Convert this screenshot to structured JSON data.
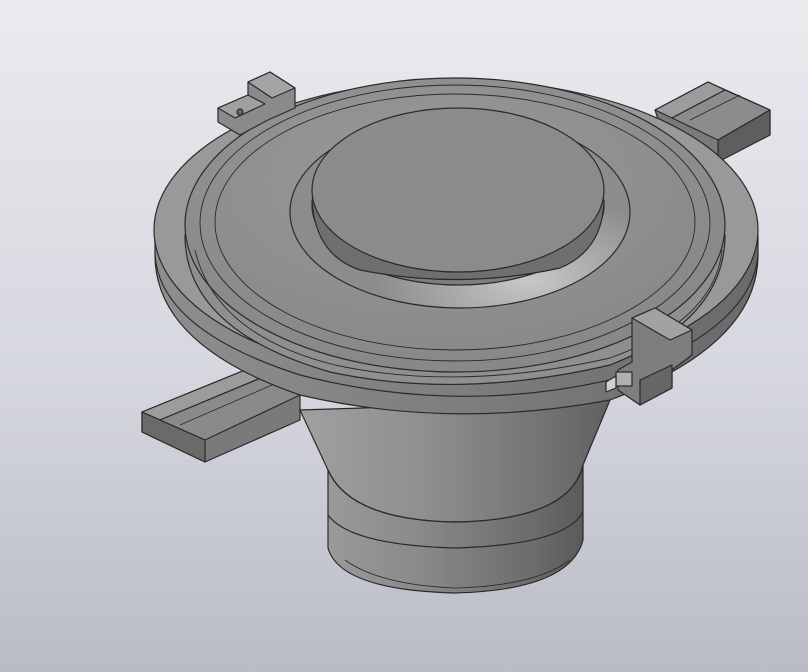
{
  "viewport": {
    "background_top": "#eaebef",
    "background_bottom": "#b9bbc6"
  },
  "model": {
    "render_style": "shaded with edges",
    "body_color": "#8c8c8c",
    "edge_color": "#2a2a2a",
    "parts": [
      "mounting-flange",
      "lid",
      "top-boss",
      "conical-body",
      "lower-cylinder",
      "bracket-left",
      "bracket-right",
      "clamp-upper-left",
      "clamp-right",
      "bolt"
    ]
  }
}
